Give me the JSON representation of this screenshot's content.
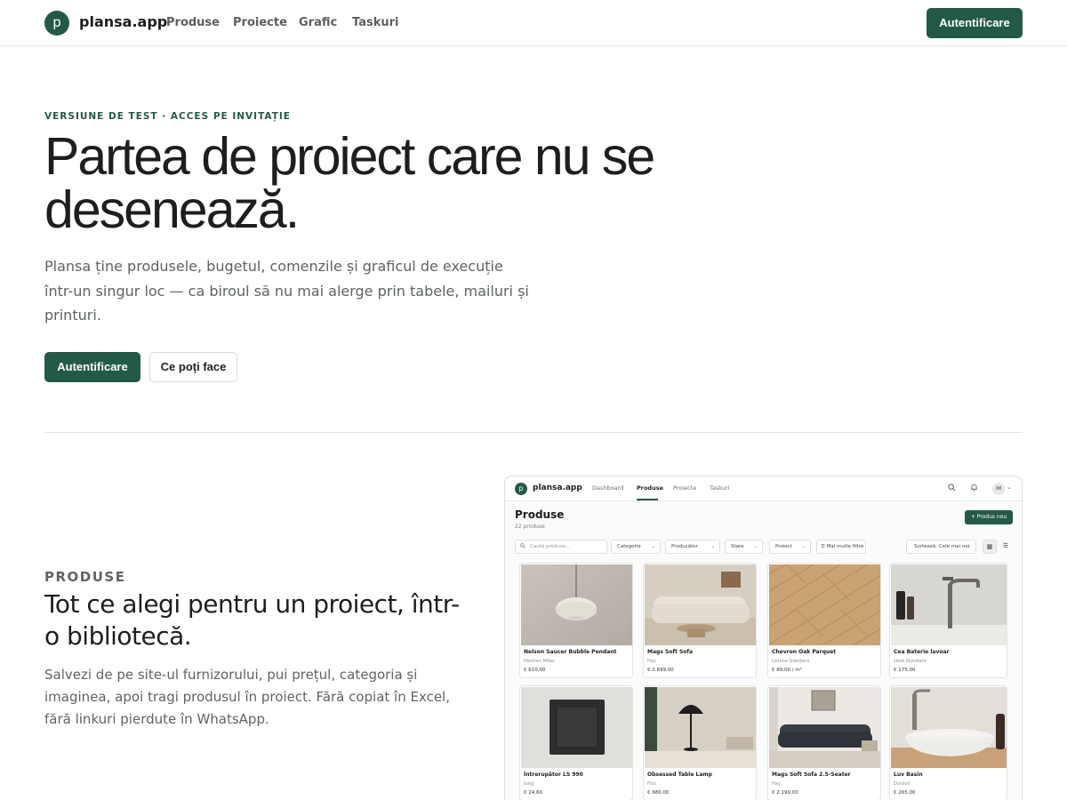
{
  "nav": {
    "logo_letter": "p",
    "brand": "plansa.app",
    "links": [
      "Produse",
      "Proiecte",
      "Grafic",
      "Taskuri"
    ],
    "login": "Autentificare"
  },
  "hero": {
    "eyebrow": "VERSIUNE DE TEST · ACCES PE INVITAȚIE",
    "title": "Partea de proiect care nu se desenează.",
    "description": "Plansa ține produsele, bugetul, comenzile și graficul de execuție într-un singur loc — ca biroul să nu mai alerge prin tabele, mailuri și printuri.",
    "primary_button": "Autentificare",
    "secondary_button": "Ce poți face"
  },
  "feature": {
    "eyebrow": "PRODUSE",
    "title": "Tot ce alegi pentru un proiect, într-o bibliotecă.",
    "description": "Salvezi de pe site-ul furnizorului, pui prețul, categoria și imaginea, apoi tragi produsul în proiect. Fără copiat în Excel, fără linkuri pierdute în WhatsApp."
  },
  "mockup": {
    "logo_letter": "p",
    "brand": "plansa.app",
    "nav_links": [
      "Dashboard",
      "Produse",
      "Proiecte",
      "Taskuri"
    ],
    "active_tab": "Produse",
    "avatar": "IM",
    "page_title": "Produse",
    "count": "22 produse",
    "add_button": "+ Produs nou",
    "search_placeholder": "Caută produse...",
    "filters": [
      "Categorie",
      "Producător",
      "Stare",
      "Proiect"
    ],
    "more_filters": "Mai multe filtre",
    "sort": "Sortează: Cele mai noi",
    "products": [
      {
        "name": "Nelson Saucer Bubble Pendant",
        "brand": "Herman Miller",
        "price": "€ 610,00"
      },
      {
        "name": "Mags Soft Sofa",
        "brand": "Hay",
        "price": "€ 2.699,00"
      },
      {
        "name": "Chevron Oak Parquet",
        "brand": "Listone Giordano",
        "price": "€ 89,00 / m²"
      },
      {
        "name": "Cea Baterie lavoar",
        "brand": "Ideal Standard",
        "price": "€ 175,00"
      },
      {
        "name": "Întrerupător LS 990",
        "brand": "Jung",
        "price": "€ 24,60"
      },
      {
        "name": "Obsessed Table Lamp",
        "brand": "Flos",
        "price": "€ 680,00"
      },
      {
        "name": "Mags Soft Sofa 2.5-Seater",
        "brand": "Hay",
        "price": "€ 2.199,00"
      },
      {
        "name": "Luv Basin",
        "brand": "Duravit",
        "price": "€ 265,00"
      }
    ]
  },
  "colors": {
    "accent": "#225a47",
    "text": "#1c1f1e",
    "muted": "#5e6462",
    "border": "#e1e3e2"
  }
}
